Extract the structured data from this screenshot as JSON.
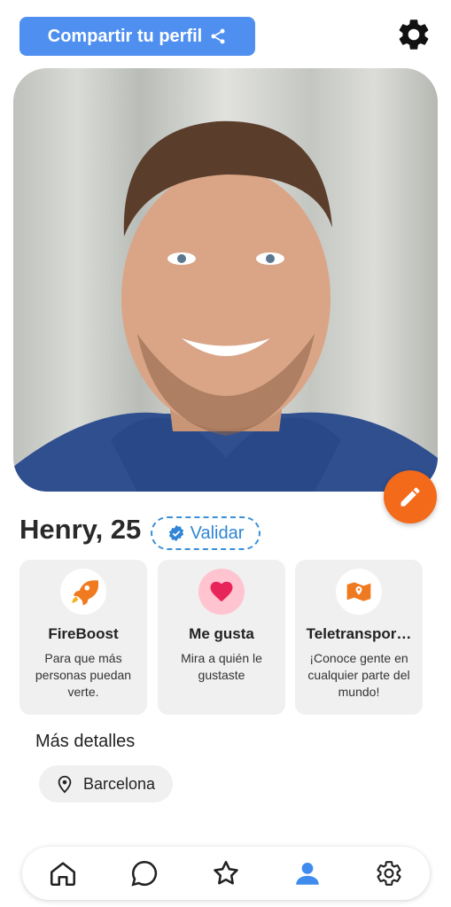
{
  "header": {
    "share_label": "Compartir tu perfil"
  },
  "profile": {
    "name_age": "Henry, 25",
    "validate_label": "Validar"
  },
  "cards": [
    {
      "title": "FireBoost",
      "desc": "Para que más personas puedan verte.",
      "icon": "rocket-icon"
    },
    {
      "title": "Me gusta",
      "desc": "Mira a quién le gustaste",
      "icon": "heart-icon"
    },
    {
      "title": "Teletranspor…",
      "desc": "¡Conoce gente en cualquier parte del mundo!",
      "icon": "map-icon"
    }
  ],
  "details": {
    "title": "Más detalles",
    "city": "Barcelona"
  },
  "nav": [
    "home-icon",
    "chat-icon",
    "star-icon",
    "profile-icon",
    "settings-icon"
  ],
  "colors": {
    "accent": "#4f8ff0",
    "edit": "#f36a1b",
    "validate": "#2f86d6",
    "nav_active": "#3f8cee",
    "heart_bg": "#ffc4cf",
    "heart": "#e8255a"
  }
}
